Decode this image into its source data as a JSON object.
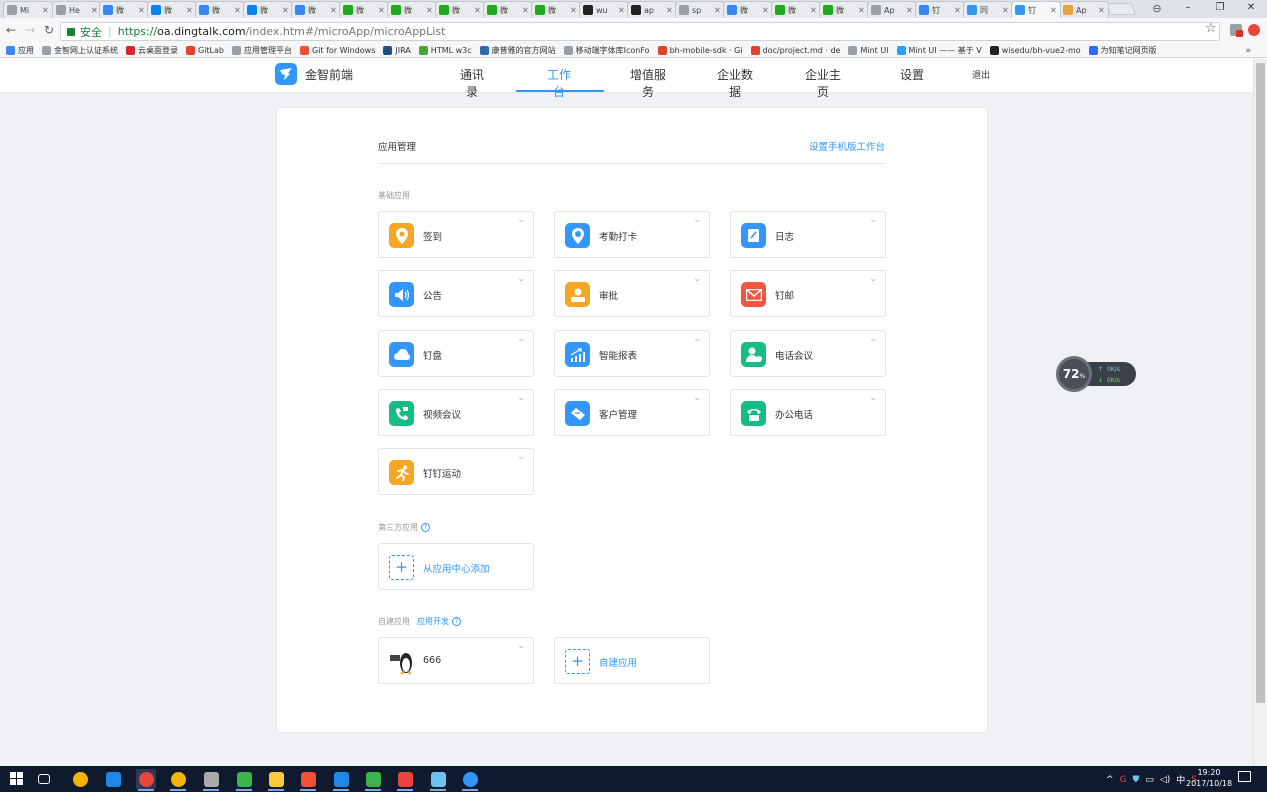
{
  "browser": {
    "tabs": [
      {
        "title": "Mi",
        "color": "#9aa0a6"
      },
      {
        "title": "He",
        "color": "#9aa0a6"
      },
      {
        "title": "微",
        "color": "#3388ff"
      },
      {
        "title": "微",
        "color": "#0084ff"
      },
      {
        "title": "微",
        "color": "#3388ff"
      },
      {
        "title": "微",
        "color": "#0084ff"
      },
      {
        "title": "微",
        "color": "#3388ff"
      },
      {
        "title": "微",
        "color": "#1aad19"
      },
      {
        "title": "微",
        "color": "#1aad19"
      },
      {
        "title": "微",
        "color": "#1aad19"
      },
      {
        "title": "微",
        "color": "#1aad19"
      },
      {
        "title": "微",
        "color": "#1aad19"
      },
      {
        "title": "wu",
        "color": "#222222"
      },
      {
        "title": "ap",
        "color": "#222222"
      },
      {
        "title": "sp",
        "color": "#9aa0a6"
      },
      {
        "title": "微",
        "color": "#3388ff"
      },
      {
        "title": "微",
        "color": "#1aad19"
      },
      {
        "title": "微",
        "color": "#1aad19"
      },
      {
        "title": "Ap",
        "color": "#9aa0a6"
      },
      {
        "title": "钉",
        "color": "#3388ff"
      },
      {
        "title": "同",
        "color": "#3296fa"
      },
      {
        "title": "钉",
        "color": "#3296fa"
      },
      {
        "title": "Ap",
        "color": "#e8a33d"
      }
    ],
    "secure_label": "安全",
    "url_scheme": "https://",
    "url_host": "oa.dingtalk.com",
    "url_path": "/index.htm#/microApp/microAppList",
    "bookmarks": [
      {
        "label": "应用",
        "color": "#4285f4"
      },
      {
        "label": "金智网上认证系统",
        "color": "#9aa0a6"
      },
      {
        "label": "云桌面登录",
        "color": "#d3272e"
      },
      {
        "label": "GitLab",
        "color": "#e24329"
      },
      {
        "label": "应用管理平台",
        "color": "#9aa0a6"
      },
      {
        "label": "Git for Windows",
        "color": "#f05033"
      },
      {
        "label": "JIRA",
        "color": "#205081"
      },
      {
        "label": "HTML w3c",
        "color": "#46a832"
      },
      {
        "label": "康普雅的官方网站",
        "color": "#2b6cb0"
      },
      {
        "label": "移动端字体库IconFo",
        "color": "#9aa0a6"
      },
      {
        "label": "bh-mobile-sdk · Gi",
        "color": "#e24329"
      },
      {
        "label": "doc/project.md · de",
        "color": "#e24329"
      },
      {
        "label": "Mint UI",
        "color": "#9aa0a6"
      },
      {
        "label": "Mint UI —— 基于 V",
        "color": "#26a2ff"
      },
      {
        "label": "wisedu/bh-vue2-mo",
        "color": "#222222"
      },
      {
        "label": "为知笔记网页版",
        "color": "#2b6cff"
      }
    ],
    "bookmarks_more": "»"
  },
  "header": {
    "corp_name": "金智前端",
    "nav": [
      "通讯录",
      "工作台",
      "增值服务",
      "企业数据",
      "企业主页",
      "设置"
    ],
    "active_index": 1,
    "logout": "退出"
  },
  "card": {
    "title": "应用管理",
    "mobile_link": "设置手机版工作台",
    "sections": {
      "basic": "基础应用",
      "third_party": "第三方应用",
      "custom": "自建应用",
      "custom_dev_link": "应用开发"
    },
    "basic_apps": [
      {
        "label": "签到",
        "icon": "location-pin-icon",
        "color": "#f5a623"
      },
      {
        "label": "考勤打卡",
        "icon": "location-clock-icon",
        "color": "#3296fa"
      },
      {
        "label": "日志",
        "icon": "notebook-icon",
        "color": "#3296fa"
      },
      {
        "label": "公告",
        "icon": "megaphone-icon",
        "color": "#3296fa"
      },
      {
        "label": "审批",
        "icon": "user-stamp-icon",
        "color": "#f5a623"
      },
      {
        "label": "钉邮",
        "icon": "mail-icon",
        "color": "#f25643"
      },
      {
        "label": "钉盘",
        "icon": "cloud-icon",
        "color": "#3296fa"
      },
      {
        "label": "智能报表",
        "icon": "chart-up-icon",
        "color": "#3296fa"
      },
      {
        "label": "电话会议",
        "icon": "person-phone-icon",
        "color": "#15bc83"
      },
      {
        "label": "视频会议",
        "icon": "video-phone-icon",
        "color": "#15bc83"
      },
      {
        "label": "客户管理",
        "icon": "handshake-icon",
        "color": "#3296fa"
      },
      {
        "label": "办公电话",
        "icon": "telephone-icon",
        "color": "#15bc83"
      },
      {
        "label": "钉钉运动",
        "icon": "running-icon",
        "color": "#f5a623"
      }
    ],
    "third_party_add": "从应用中心添加",
    "custom_apps": [
      {
        "label": "666",
        "icon": "linux-penguin-icon"
      }
    ],
    "custom_add": "自建应用"
  },
  "net_widget": {
    "percent": "72",
    "percent_unit": "%",
    "up": "0K/s",
    "down": "0K/s"
  },
  "taskbar": {
    "time": "19:20",
    "date": "2017/10/18",
    "ime": "中",
    "apps": [
      {
        "name": "task-view",
        "color": "#ffffff"
      },
      {
        "name": "pinwheel",
        "color": "#f4b400"
      },
      {
        "name": "edge",
        "color": "#1e88e5"
      },
      {
        "name": "chrome",
        "color": "#e8453c"
      },
      {
        "name": "chrome-canary",
        "color": "#f4b400"
      },
      {
        "name": "terminal",
        "color": "#aaaaaa"
      },
      {
        "name": "sourcetree",
        "color": "#39b54a"
      },
      {
        "name": "explorer",
        "color": "#ffc83d"
      },
      {
        "name": "git-gui",
        "color": "#f05033"
      },
      {
        "name": "webstorm",
        "color": "#1e88e5"
      },
      {
        "name": "code-editor",
        "color": "#39b54a"
      },
      {
        "name": "red-app",
        "color": "#e8453c"
      },
      {
        "name": "screenshot",
        "color": "#6dc3f0"
      },
      {
        "name": "dingtalk",
        "color": "#3296fa"
      }
    ]
  }
}
